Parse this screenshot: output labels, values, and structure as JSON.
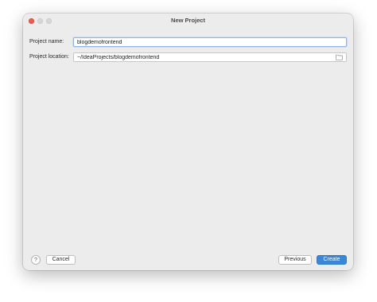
{
  "window": {
    "title": "New Project"
  },
  "form": {
    "name_label": "Project name:",
    "name_value": "blogdemofrontend",
    "location_label": "Project location:",
    "location_value": "~/IdeaProjects/blogdemofrontend"
  },
  "footer": {
    "help_label": "?",
    "cancel_label": "Cancel",
    "previous_label": "Previous",
    "create_label": "Create"
  },
  "colors": {
    "accent": "#3c86d6",
    "close": "#ee5a52",
    "window_bg": "#ececec"
  },
  "icons": {
    "folder": "folder-icon"
  }
}
